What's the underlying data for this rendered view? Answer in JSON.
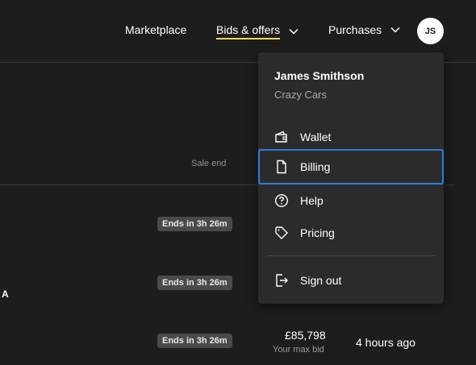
{
  "nav": {
    "marketplace_label": "Marketplace",
    "bids_label": "Bids & offers",
    "purchases_label": "Purchases",
    "avatar_initials": "JS",
    "active_color": "#f2d74a"
  },
  "table": {
    "sale_end_header": "Sale end",
    "rows": [
      {
        "badge": "Ends in 3h 26m"
      },
      {
        "badge": "Ends in 3h 26m",
        "letter": "A"
      },
      {
        "badge": "Ends in 3h 26m",
        "price": "£85,798",
        "price_sub": "Your max bid",
        "time_ago": "4 hours ago"
      }
    ]
  },
  "menu": {
    "user_name": "James Smithson",
    "company": "Crazy Cars",
    "items": [
      {
        "label": "Wallet",
        "icon": "wallet-icon"
      },
      {
        "label": "Billing",
        "icon": "document-icon",
        "focused": true
      },
      {
        "label": "Help",
        "icon": "help-circle-icon"
      },
      {
        "label": "Pricing",
        "icon": "price-tag-icon"
      }
    ],
    "sign_out": {
      "label": "Sign out",
      "icon": "sign-out-icon"
    },
    "focus_color": "#2f7fd8"
  }
}
